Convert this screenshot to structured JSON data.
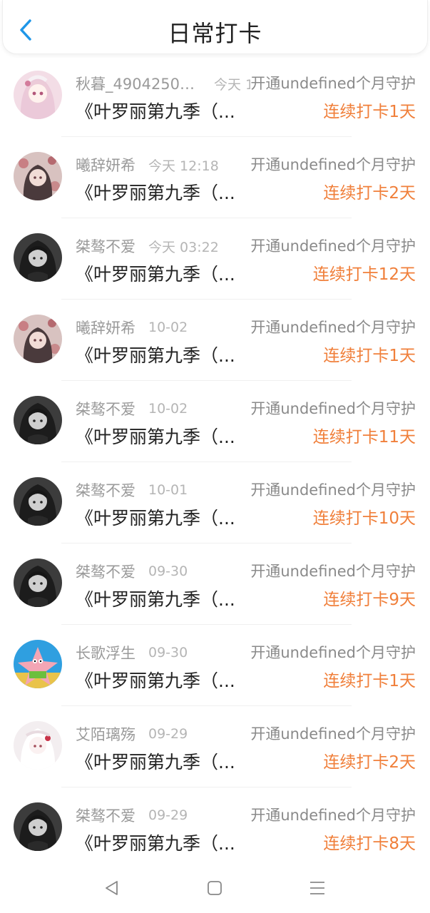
{
  "header": {
    "title": "日常打卡",
    "back_icon": "chevron-left-icon",
    "accent": "#1e96e8"
  },
  "colors": {
    "streak": "#f07f3a"
  },
  "items": [
    {
      "username": "秋暮_49042500...",
      "time": "今天 11:..",
      "guard": "开通undefined个月守护",
      "song": "《叶罗丽第九季（...",
      "streak": "连续打卡1天",
      "avatar": "avatar-anime-girl-pink"
    },
    {
      "username": "曦辞妍希",
      "time": "今天 12:18",
      "guard": "开通undefined个月守护",
      "song": "《叶罗丽第九季（...",
      "streak": "连续打卡2天",
      "avatar": "avatar-anime-girl-flowers"
    },
    {
      "username": "桀骜不爱",
      "time": "今天 03:22",
      "guard": "开通undefined个月守护",
      "song": "《叶罗丽第九季（...",
      "streak": "连续打卡12天",
      "avatar": "avatar-anime-girl-dark"
    },
    {
      "username": "曦辞妍希",
      "time": "10-02",
      "guard": "开通undefined个月守护",
      "song": "《叶罗丽第九季（...",
      "streak": "连续打卡1天",
      "avatar": "avatar-anime-girl-flowers"
    },
    {
      "username": "桀骜不爱",
      "time": "10-02",
      "guard": "开通undefined个月守护",
      "song": "《叶罗丽第九季（...",
      "streak": "连续打卡11天",
      "avatar": "avatar-anime-girl-dark"
    },
    {
      "username": "桀骜不爱",
      "time": "10-01",
      "guard": "开通undefined个月守护",
      "song": "《叶罗丽第九季（...",
      "streak": "连续打卡10天",
      "avatar": "avatar-anime-girl-dark"
    },
    {
      "username": "桀骜不爱",
      "time": "09-30",
      "guard": "开通undefined个月守护",
      "song": "《叶罗丽第九季（...",
      "streak": "连续打卡9天",
      "avatar": "avatar-anime-girl-dark"
    },
    {
      "username": "长歌浮生",
      "time": "09-30",
      "guard": "开通undefined个月守护",
      "song": "《叶罗丽第九季（...",
      "streak": "连续打卡1天",
      "avatar": "avatar-cartoon-starfish"
    },
    {
      "username": "艾陌璃殇",
      "time": "09-29",
      "guard": "开通undefined个月守护",
      "song": "《叶罗丽第九季（...",
      "streak": "连续打卡2天",
      "avatar": "avatar-anime-girl-white"
    },
    {
      "username": "桀骜不爱",
      "time": "09-29",
      "guard": "开通undefined个月守护",
      "song": "《叶罗丽第九季（...",
      "streak": "连续打卡8天",
      "avatar": "avatar-anime-girl-dark"
    }
  ],
  "navbar": {
    "back": "triangle-back-icon",
    "home": "square-home-icon",
    "menu": "hamburger-menu-icon"
  }
}
